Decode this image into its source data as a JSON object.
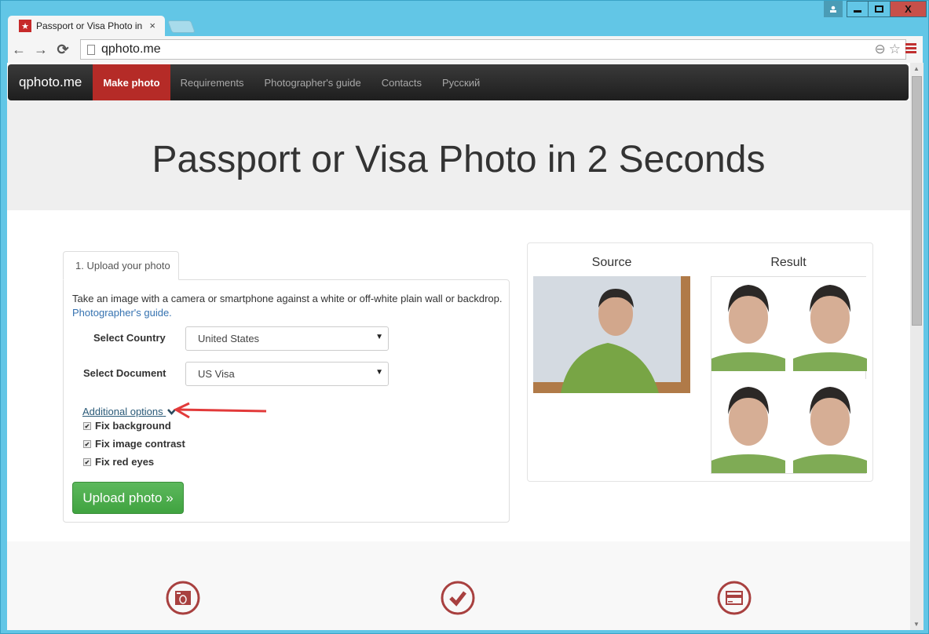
{
  "browser": {
    "tab_title": "Passport or Visa Photo in",
    "tab_close": "×",
    "url": "qphoto.me",
    "nav": {
      "back": "←",
      "forward": "→",
      "reload": "⟳"
    },
    "icons": {
      "zoom": "⊖",
      "star": "☆"
    },
    "window_controls": {
      "minimize": "▁",
      "maximize": "□",
      "close": "X"
    }
  },
  "site": {
    "brand": "qphoto.me",
    "nav_items": [
      {
        "label": "Make photo",
        "active": true
      },
      {
        "label": "Requirements"
      },
      {
        "label": "Photographer's guide"
      },
      {
        "label": "Contacts"
      },
      {
        "label": "Русский"
      }
    ],
    "hero_title": "Passport or Visa Photo in 2 Seconds"
  },
  "upload": {
    "tab_label": "1. Upload your photo",
    "intro_text": "Take an image with a camera or smartphone against a white or off-white plain wall or backdrop.",
    "guide_link": "Photographer's guide.",
    "country_label": "Select Country",
    "country_value": "United States",
    "document_label": "Select Document",
    "document_value": "US Visa",
    "caret": "▼",
    "additional_options": "Additional options",
    "checkboxes": [
      {
        "label": "Fix background",
        "checked": true
      },
      {
        "label": "Fix image contrast",
        "checked": true
      },
      {
        "label": "Fix red eyes",
        "checked": true
      }
    ],
    "upload_button": "Upload photo »"
  },
  "preview": {
    "source_label": "Source",
    "result_label": "Result"
  },
  "features": {
    "icons": [
      "camera-icon",
      "checkmark-icon",
      "credit-card-icon"
    ]
  },
  "colors": {
    "accent_red": "#b52b27",
    "upload_green": "#5cb85c",
    "link_blue": "#3572b0",
    "feature_icon": "#a8403f"
  }
}
